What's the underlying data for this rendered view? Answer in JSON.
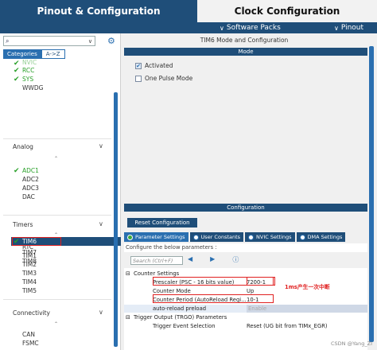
{
  "top_tabs": {
    "pinout": "Pinout & Configuration",
    "clock": "Clock Configuration"
  },
  "sub_menu": {
    "software_packs": "Software Packs",
    "pinout": "Pinout"
  },
  "left": {
    "category_tabs": [
      "Categories",
      "A->Z"
    ],
    "items_top": [
      {
        "label": "NVIC",
        "checked": true
      },
      {
        "label": "RCC",
        "checked": true
      },
      {
        "label": "SYS",
        "checked": true
      },
      {
        "label": "WWDG",
        "checked": false
      }
    ],
    "analog": {
      "title": "Analog",
      "items": [
        {
          "label": "ADC1",
          "checked": true
        },
        {
          "label": "ADC2",
          "checked": false
        },
        {
          "label": "ADC3",
          "checked": false
        },
        {
          "label": "DAC",
          "checked": false
        }
      ]
    },
    "timers": {
      "title": "Timers",
      "items": [
        {
          "label": "RTC",
          "checked": false
        },
        {
          "label": "TIM1",
          "checked": false
        },
        {
          "label": "TIM2",
          "checked": false
        },
        {
          "label": "TIM3",
          "checked": false
        },
        {
          "label": "TIM4",
          "checked": false
        },
        {
          "label": "TIM5",
          "checked": false
        },
        {
          "label": "TIM6",
          "checked": true
        },
        {
          "label": "TIM7",
          "checked": false
        },
        {
          "label": "TIM8",
          "checked": false
        }
      ]
    },
    "connectivity": {
      "title": "Connectivity",
      "items": [
        {
          "label": "CAN",
          "checked": false
        },
        {
          "label": "FSMC",
          "checked": false
        }
      ]
    }
  },
  "right": {
    "title": "TIM6 Mode and Configuration",
    "mode_header": "Mode",
    "activated_label": "Activated",
    "activated_checked": true,
    "one_pulse_label": "One Pulse Mode",
    "one_pulse_checked": false,
    "config_header": "Configuration",
    "reset_button": "Reset Configuration",
    "tabs": [
      "Parameter Settings",
      "User Constants",
      "NVIC Settings",
      "DMA Settings"
    ],
    "active_tab": "Parameter Settings",
    "configure_text": "Configure the below parameters :",
    "search_placeholder": "Search (Ctrl+F)",
    "params": {
      "counter_settings": "Counter Settings",
      "prescaler_label": "Prescaler (PSC - 16 bits value)",
      "prescaler_value": "7200-1",
      "counter_mode_label": "Counter Mode",
      "counter_mode_value": "Up",
      "period_label": "Counter Period (AutoReload Regi...",
      "period_value": "10-1",
      "autoreload_label": "auto-reload preload",
      "autoreload_value": "Enable",
      "trgo_header": "Trigger Output (TRGO) Parameters",
      "trigger_label": "Trigger Event Selection",
      "trigger_value": "Reset (UG bit from TIMx_EGR)"
    },
    "annotation": "1ms产生一次中断"
  },
  "watermark": "CSDN @Yang_ZI"
}
